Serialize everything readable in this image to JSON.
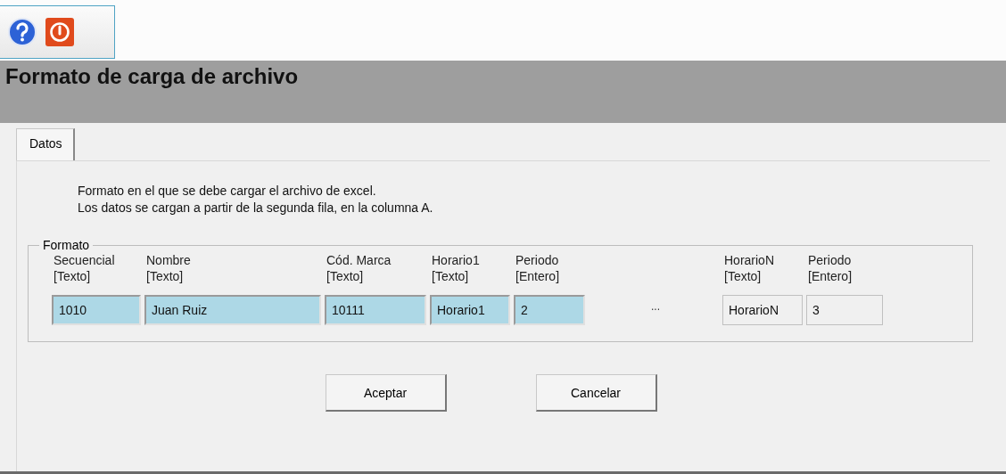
{
  "toolbar": {
    "buttons": [
      {
        "kind": "help"
      },
      {
        "kind": "power"
      }
    ]
  },
  "title": "Formato de carga de archivo",
  "tabs": [
    {
      "label": "Datos",
      "selected": true
    }
  ],
  "description": [
    "Formato en el que se debe cargar el archivo de excel.",
    "Los datos se cargan a partir de la segunda fila, en la columna A."
  ],
  "group": {
    "legend": "Formato",
    "columns": [
      {
        "kind": "field",
        "name": "Secuencial",
        "type": "[Texto]",
        "value": "1010",
        "highlighted": true
      },
      {
        "kind": "field",
        "name": "Nombre",
        "type": "[Texto]",
        "value": "Juan Ruiz",
        "highlighted": true
      },
      {
        "kind": "field",
        "name": "Cód. Marca",
        "type": "[Texto]",
        "value": "10111",
        "highlighted": true
      },
      {
        "kind": "field",
        "name": "Horario1",
        "type": "[Texto]",
        "value": "Horario1",
        "highlighted": true
      },
      {
        "kind": "field",
        "name": "Periodo",
        "type": "[Entero]",
        "value": "2",
        "highlighted": true
      },
      {
        "kind": "ellipsis",
        "text": "..."
      },
      {
        "kind": "field",
        "name": "HorarioN",
        "type": "[Texto]",
        "value": "HorarioN",
        "highlighted": false
      },
      {
        "kind": "field",
        "name": "Periodo",
        "type": "[Entero]",
        "value": "3",
        "highlighted": false
      }
    ]
  },
  "buttons": [
    "Aceptar",
    "Cancelar"
  ]
}
